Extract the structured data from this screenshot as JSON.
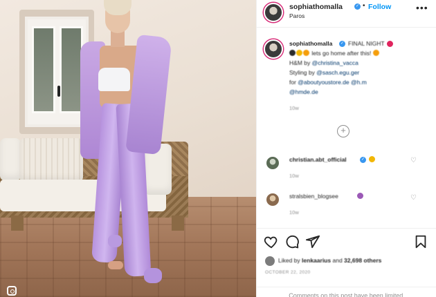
{
  "header": {
    "username": "sophiathomalla",
    "follow_label": "Follow",
    "separator": "•",
    "location": "Paros",
    "more_label": "•••"
  },
  "caption": {
    "username": "sophiathomalla",
    "text_line1": "FINAL NIGHT",
    "text_line2": "lets go home after this!",
    "line3_prefix": "H&M by",
    "line3_mention": "@christina_vacca",
    "line4_prefix": "Styling by",
    "line4_mention": "@sasch.egu.ger",
    "line5_prefix": "for",
    "line5_mention1": "@aboutyoustore.de",
    "line5_mention2": "@h.m",
    "line6_mention": "@hmde.de",
    "time": "10w"
  },
  "load_more_label": "+",
  "comments": [
    {
      "username": "christian.abt_official",
      "time": "10w"
    },
    {
      "username": "stralsbien_blogsee",
      "time": "10w"
    }
  ],
  "likes": {
    "prefix": "Liked by",
    "user": "lenkaarius",
    "middle": "and",
    "count": "32,698 others"
  },
  "date": "OCTOBER 22, 2020",
  "limited_notice": "Comments on this post have been limited.",
  "colors": {
    "link": "#0095f6",
    "mention": "#00376b",
    "verified": "#3897f0",
    "secondary_text": "#8e8e8e",
    "suit_lilac": "#c3a3e6"
  },
  "icons": {
    "heart": "heart-icon",
    "comment": "comment-icon",
    "share": "share-icon",
    "save": "bookmark-icon",
    "instagram": "instagram-icon"
  }
}
